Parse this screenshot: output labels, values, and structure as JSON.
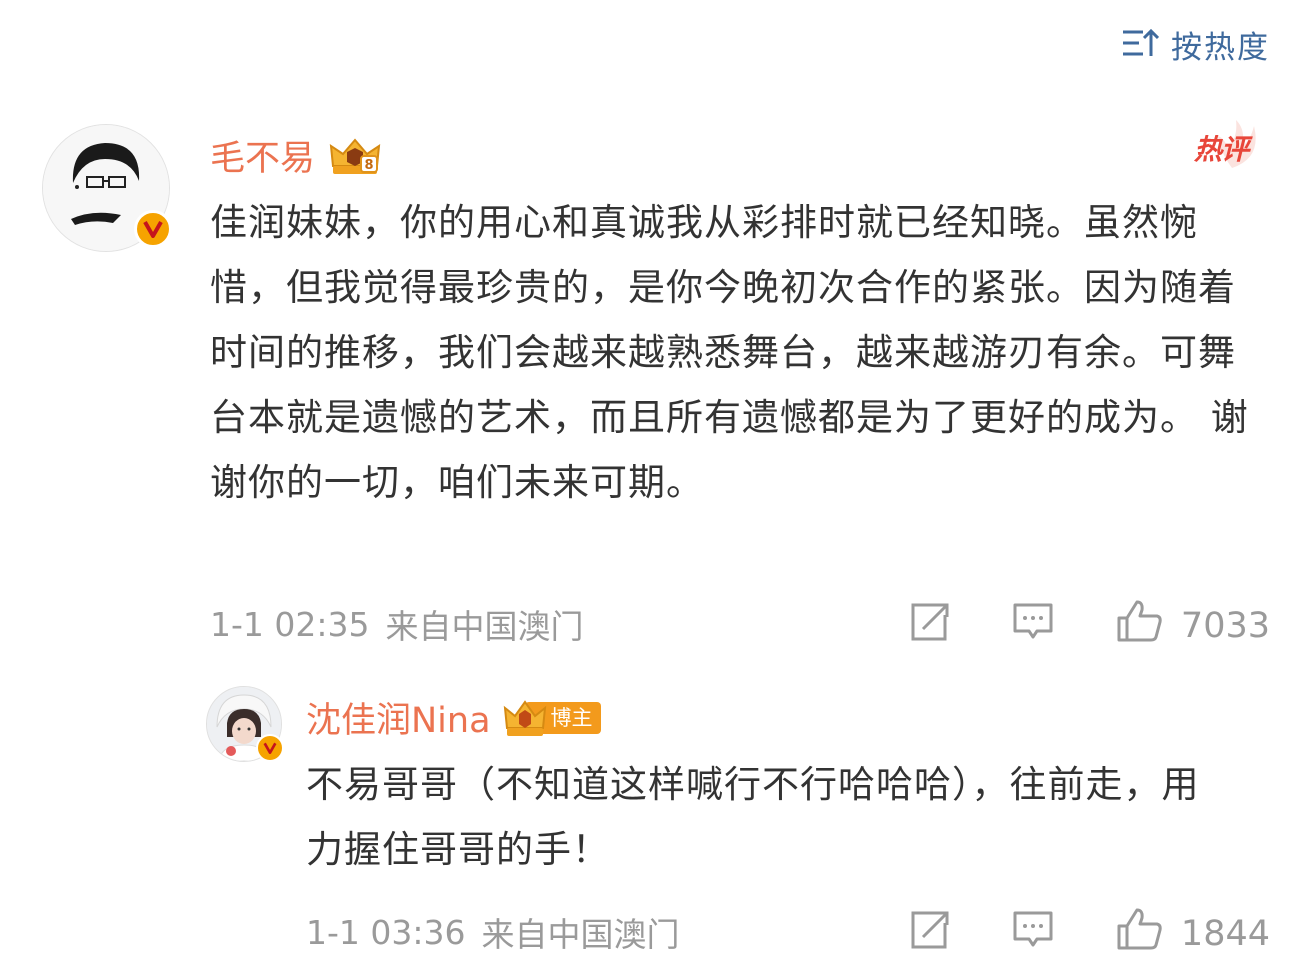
{
  "sort": {
    "label": "按热度",
    "icon": "sort-icon"
  },
  "colors": {
    "username": "#eb7350",
    "link": "#3f6a9d",
    "text": "#333333",
    "meta": "#9a9a9a",
    "hot": "#e8463a",
    "badge": "#f6a300"
  },
  "comments": [
    {
      "username": "毛不易",
      "badge": "crown-level-8-icon",
      "hot_label": "热评",
      "text": "佳润妹妹，你的用心和真诚我从彩排时就已经知晓。虽然惋惜，但我觉得最珍贵的，是你今晚初次合作的紧张。因为随着时间的推移，我们会越来越熟悉舞台，越来越游刃有余。可舞台本就是遗憾的艺术，而且所有遗憾都是为了更好的成为。 谢谢你的一切，咱们未来可期。",
      "time": "1-1 02:35",
      "location": "来自中国澳门",
      "likes": "7033"
    },
    {
      "username": "沈佳润Nina",
      "badge": "crown-icon",
      "role_tag": "博主",
      "text": "不易哥哥（不知道这样喊行不行哈哈哈），往前走，用力握住哥哥的手！",
      "time": "1-1 03:36",
      "location": "来自中国澳门",
      "likes": "1844"
    }
  ]
}
